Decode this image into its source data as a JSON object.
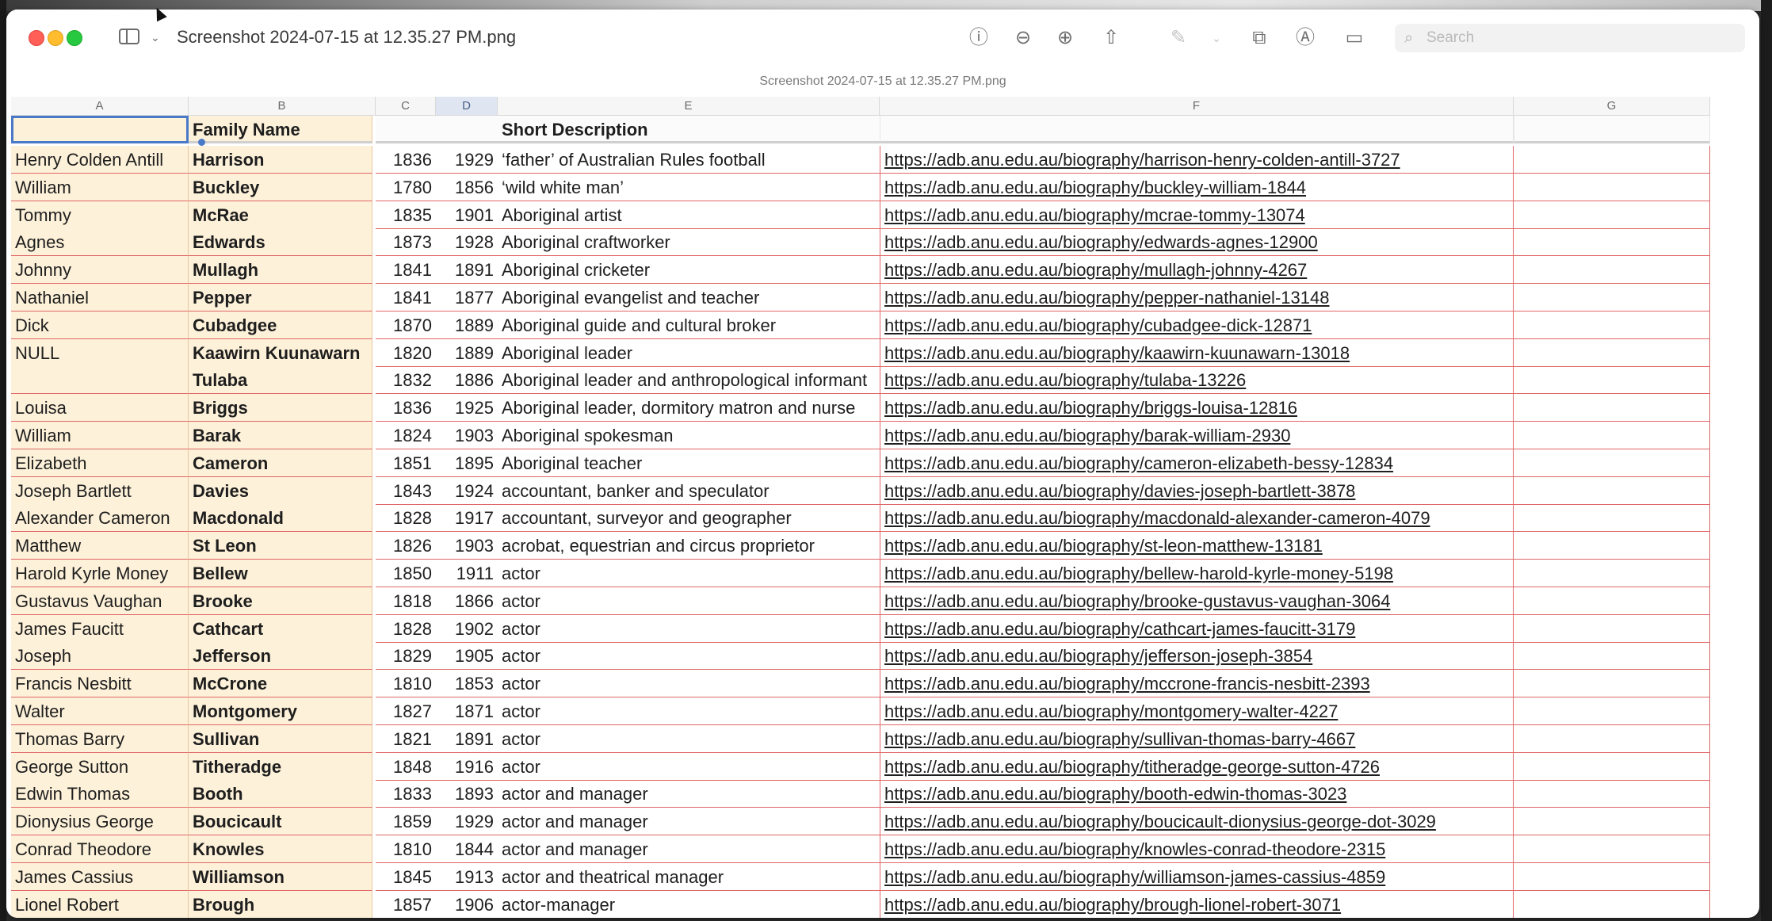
{
  "window": {
    "title": "Screenshot 2024-07-15 at 12.35.27 PM.png",
    "subtitle": "Screenshot 2024-07-15 at 12.35.27 PM.png",
    "search_placeholder": "Search"
  },
  "toolbar_icons": [
    "info-icon",
    "zoom-out-icon",
    "zoom-in-icon",
    "share-icon",
    "markup-pen-icon",
    "chevron-down-icon",
    "rotate-icon",
    "markup-circle-icon",
    "annotate-icon"
  ],
  "columns": [
    "A",
    "B",
    "C",
    "D",
    "E",
    "F",
    "G"
  ],
  "selected_column": "D",
  "header": {
    "family_name": "Family Name",
    "short_description": "Short Description"
  },
  "rows": [
    {
      "given": "Henry Colden Antill",
      "family": "Harrison",
      "born": "1836",
      "died": "1929",
      "desc": "‘father’ of Australian Rules football",
      "url": "https://adb.anu.edu.au/biography/harrison-henry-colden-antill-3727"
    },
    {
      "given": "William",
      "family": "Buckley",
      "born": "1780",
      "died": "1856",
      "desc": "‘wild white man’",
      "url": "https://adb.anu.edu.au/biography/buckley-william-1844"
    },
    {
      "given": "Tommy",
      "family": "McRae",
      "born": "1835",
      "died": "1901",
      "desc": "Aboriginal artist",
      "url": "https://adb.anu.edu.au/biography/mcrae-tommy-13074"
    },
    {
      "given": "Agnes",
      "family": "Edwards",
      "born": "1873",
      "died": "1928",
      "desc": "Aboriginal craftworker",
      "url": "https://adb.anu.edu.au/biography/edwards-agnes-12900"
    },
    {
      "given": "Johnny",
      "family": "Mullagh",
      "born": "1841",
      "died": "1891",
      "desc": "Aboriginal cricketer",
      "url": "https://adb.anu.edu.au/biography/mullagh-johnny-4267"
    },
    {
      "given": "Nathaniel",
      "family": "Pepper",
      "born": "1841",
      "died": "1877",
      "desc": "Aboriginal evangelist and teacher",
      "url": "https://adb.anu.edu.au/biography/pepper-nathaniel-13148"
    },
    {
      "given": "Dick",
      "family": "Cubadgee",
      "born": "1870",
      "died": "1889",
      "desc": "Aboriginal guide and cultural broker",
      "url": "https://adb.anu.edu.au/biography/cubadgee-dick-12871"
    },
    {
      "given": "NULL",
      "family": "Kaawirn Kuunawarn",
      "born": "1820",
      "died": "1889",
      "desc": "Aboriginal leader",
      "url": "https://adb.anu.edu.au/biography/kaawirn-kuunawarn-13018"
    },
    {
      "given": "",
      "family": "Tulaba",
      "born": "1832",
      "died": "1886",
      "desc": "Aboriginal leader and anthropological informant",
      "url": "https://adb.anu.edu.au/biography/tulaba-13226"
    },
    {
      "given": "Louisa",
      "family": "Briggs",
      "born": "1836",
      "died": "1925",
      "desc": "Aboriginal leader, dormitory matron and nurse",
      "url": "https://adb.anu.edu.au/biography/briggs-louisa-12816"
    },
    {
      "given": "William",
      "family": "Barak",
      "born": "1824",
      "died": "1903",
      "desc": "Aboriginal spokesman",
      "url": "https://adb.anu.edu.au/biography/barak-william-2930"
    },
    {
      "given": "Elizabeth",
      "family": "Cameron",
      "born": "1851",
      "died": "1895",
      "desc": "Aboriginal teacher",
      "url": "https://adb.anu.edu.au/biography/cameron-elizabeth-bessy-12834"
    },
    {
      "given": "Joseph Bartlett",
      "family": "Davies",
      "born": "1843",
      "died": "1924",
      "desc": "accountant, banker and speculator",
      "url": "https://adb.anu.edu.au/biography/davies-joseph-bartlett-3878"
    },
    {
      "given": "Alexander Cameron",
      "family": "Macdonald",
      "born": "1828",
      "died": "1917",
      "desc": "accountant, surveyor and geographer",
      "url": "https://adb.anu.edu.au/biography/macdonald-alexander-cameron-4079"
    },
    {
      "given": "Matthew",
      "family": "St Leon",
      "born": "1826",
      "died": "1903",
      "desc": "acrobat, equestrian and circus proprietor",
      "url": "https://adb.anu.edu.au/biography/st-leon-matthew-13181"
    },
    {
      "given": "Harold Kyrle Money",
      "family": "Bellew",
      "born": "1850",
      "died": "1911",
      "desc": "actor",
      "url": "https://adb.anu.edu.au/biography/bellew-harold-kyrle-money-5198"
    },
    {
      "given": "Gustavus Vaughan",
      "family": "Brooke",
      "born": "1818",
      "died": "1866",
      "desc": "actor",
      "url": "https://adb.anu.edu.au/biography/brooke-gustavus-vaughan-3064"
    },
    {
      "given": "James Faucitt",
      "family": "Cathcart",
      "born": "1828",
      "died": "1902",
      "desc": "actor",
      "url": "https://adb.anu.edu.au/biography/cathcart-james-faucitt-3179"
    },
    {
      "given": "Joseph",
      "family": "Jefferson",
      "born": "1829",
      "died": "1905",
      "desc": "actor",
      "url": "https://adb.anu.edu.au/biography/jefferson-joseph-3854"
    },
    {
      "given": "Francis Nesbitt",
      "family": "McCrone",
      "born": "1810",
      "died": "1853",
      "desc": "actor",
      "url": "https://adb.anu.edu.au/biography/mccrone-francis-nesbitt-2393"
    },
    {
      "given": "Walter",
      "family": "Montgomery",
      "born": "1827",
      "died": "1871",
      "desc": "actor",
      "url": "https://adb.anu.edu.au/biography/montgomery-walter-4227"
    },
    {
      "given": "Thomas Barry",
      "family": "Sullivan",
      "born": "1821",
      "died": "1891",
      "desc": "actor",
      "url": "https://adb.anu.edu.au/biography/sullivan-thomas-barry-4667"
    },
    {
      "given": "George Sutton",
      "family": "Titheradge",
      "born": "1848",
      "died": "1916",
      "desc": "actor",
      "url": "https://adb.anu.edu.au/biography/titheradge-george-sutton-4726"
    },
    {
      "given": "Edwin Thomas",
      "family": "Booth",
      "born": "1833",
      "died": "1893",
      "desc": "actor and manager",
      "url": "https://adb.anu.edu.au/biography/booth-edwin-thomas-3023"
    },
    {
      "given": "Dionysius George",
      "family": "Boucicault",
      "born": "1859",
      "died": "1929",
      "desc": "actor and manager",
      "url": "https://adb.anu.edu.au/biography/boucicault-dionysius-george-dot-3029"
    },
    {
      "given": "Conrad Theodore",
      "family": "Knowles",
      "born": "1810",
      "died": "1844",
      "desc": "actor and manager",
      "url": "https://adb.anu.edu.au/biography/knowles-conrad-theodore-2315"
    },
    {
      "given": "James Cassius",
      "family": "Williamson",
      "born": "1845",
      "died": "1913",
      "desc": "actor and theatrical manager",
      "url": "https://adb.anu.edu.au/biography/williamson-james-cassius-4859"
    },
    {
      "given": "Lionel Robert",
      "family": "Brough",
      "born": "1857",
      "died": "1906",
      "desc": "actor-manager",
      "url": "https://adb.anu.edu.au/biography/brough-lionel-robert-3071"
    }
  ]
}
